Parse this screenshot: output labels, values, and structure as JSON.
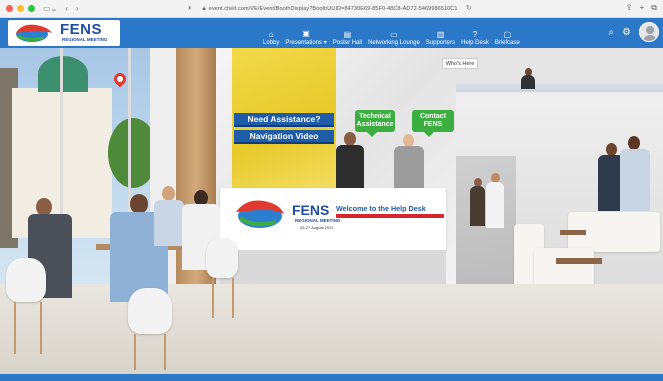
{
  "browser": {
    "url": "event.chelt.com/VE/Event/BoothDisplay?BoothUUID=84730E69-85F0-48C8-AD72-5469986510C1"
  },
  "header": {
    "logo_title": "FENS",
    "logo_subtitle": "REGIONAL MEETING",
    "nav": [
      {
        "label": "Lobby",
        "icon": "home-icon",
        "glyph": "⌂"
      },
      {
        "label": "Presentations",
        "icon": "presentation-icon",
        "glyph": "▣"
      },
      {
        "label": "Poster Hall",
        "icon": "poster-icon",
        "glyph": "▤"
      },
      {
        "label": "Networking Lounge",
        "icon": "lounge-icon",
        "glyph": "▭"
      },
      {
        "label": "Supporters",
        "icon": "supporters-icon",
        "glyph": "▥"
      },
      {
        "label": "Help Desk",
        "icon": "help-icon",
        "glyph": "?"
      },
      {
        "label": "Briefcase",
        "icon": "briefcase-icon",
        "glyph": "▢"
      }
    ]
  },
  "scene": {
    "whos_here": "Who's Here",
    "need_assistance": "Need Assistance?",
    "navigation_video": "Navigation Video",
    "technical_assistance": "Technical Assistance",
    "contact_fens": "Contact FENS",
    "desk_logo_title": "FENS",
    "desk_logo_subtitle": "REGIONAL MEETING",
    "desk_date": "25-27 August 2021",
    "desk_welcome": "Welcome to the Help Desk"
  },
  "colors": {
    "header_blue": "#2b78c8",
    "button_blue": "#1e5ca8",
    "bubble_green": "#3cae3f",
    "accent_red": "#d6262e"
  }
}
